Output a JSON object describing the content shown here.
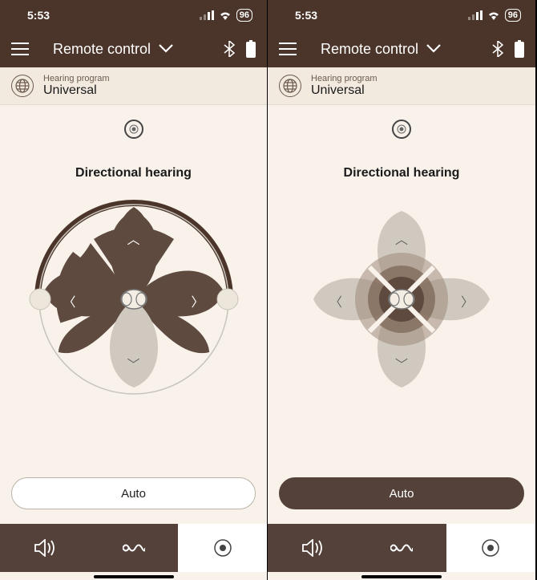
{
  "status": {
    "time": "5:53",
    "battery": "96"
  },
  "nav": {
    "title": "Remote control"
  },
  "program": {
    "label": "Hearing program",
    "name": "Universal"
  },
  "heading": "Directional hearing",
  "auto_button": "Auto",
  "colors": {
    "brand_dark": "#4B352A",
    "fill_dark": "#5E4A3E",
    "bg": "#F8F2EB",
    "muted": "#C9C4BB"
  },
  "left_screen": {
    "auto_state": "off",
    "active_tab": 2
  },
  "right_screen": {
    "auto_state": "on",
    "active_tab": 2
  }
}
